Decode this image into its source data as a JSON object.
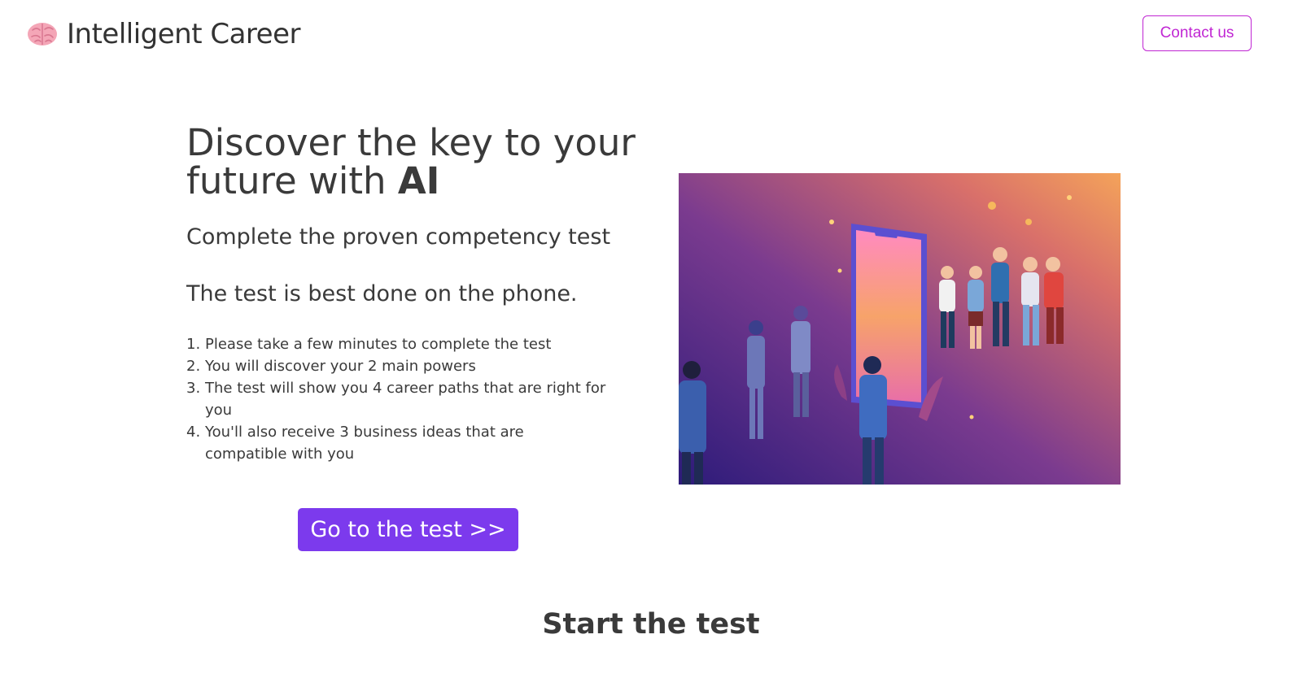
{
  "header": {
    "brand_name": "Intelligent Career",
    "contact_label": "Contact us"
  },
  "hero": {
    "title_part1": "Discover the key to your future with ",
    "title_emphasis": "AI",
    "subtitle": "Complete the proven competency test",
    "phone_note": "The test is best done on the phone.",
    "steps": [
      {
        "num": "1.",
        "text": "Please take a few minutes to complete the test"
      },
      {
        "num": "2.",
        "text": "You will discover your 2 main powers"
      },
      {
        "num": "3.",
        "text": "The test will show you 4 career paths that are right for you"
      },
      {
        "num": "4.",
        "text": "You'll also receive 3 business ideas that are compatible with you"
      }
    ],
    "cta_label": "Go to the test >>"
  },
  "section": {
    "start_title": "Start the test"
  },
  "colors": {
    "accent_magenta": "#c026d3",
    "cta_purple": "#7c3aed",
    "text": "#3a3a3a"
  },
  "icons": {
    "brand": "brain-icon"
  }
}
